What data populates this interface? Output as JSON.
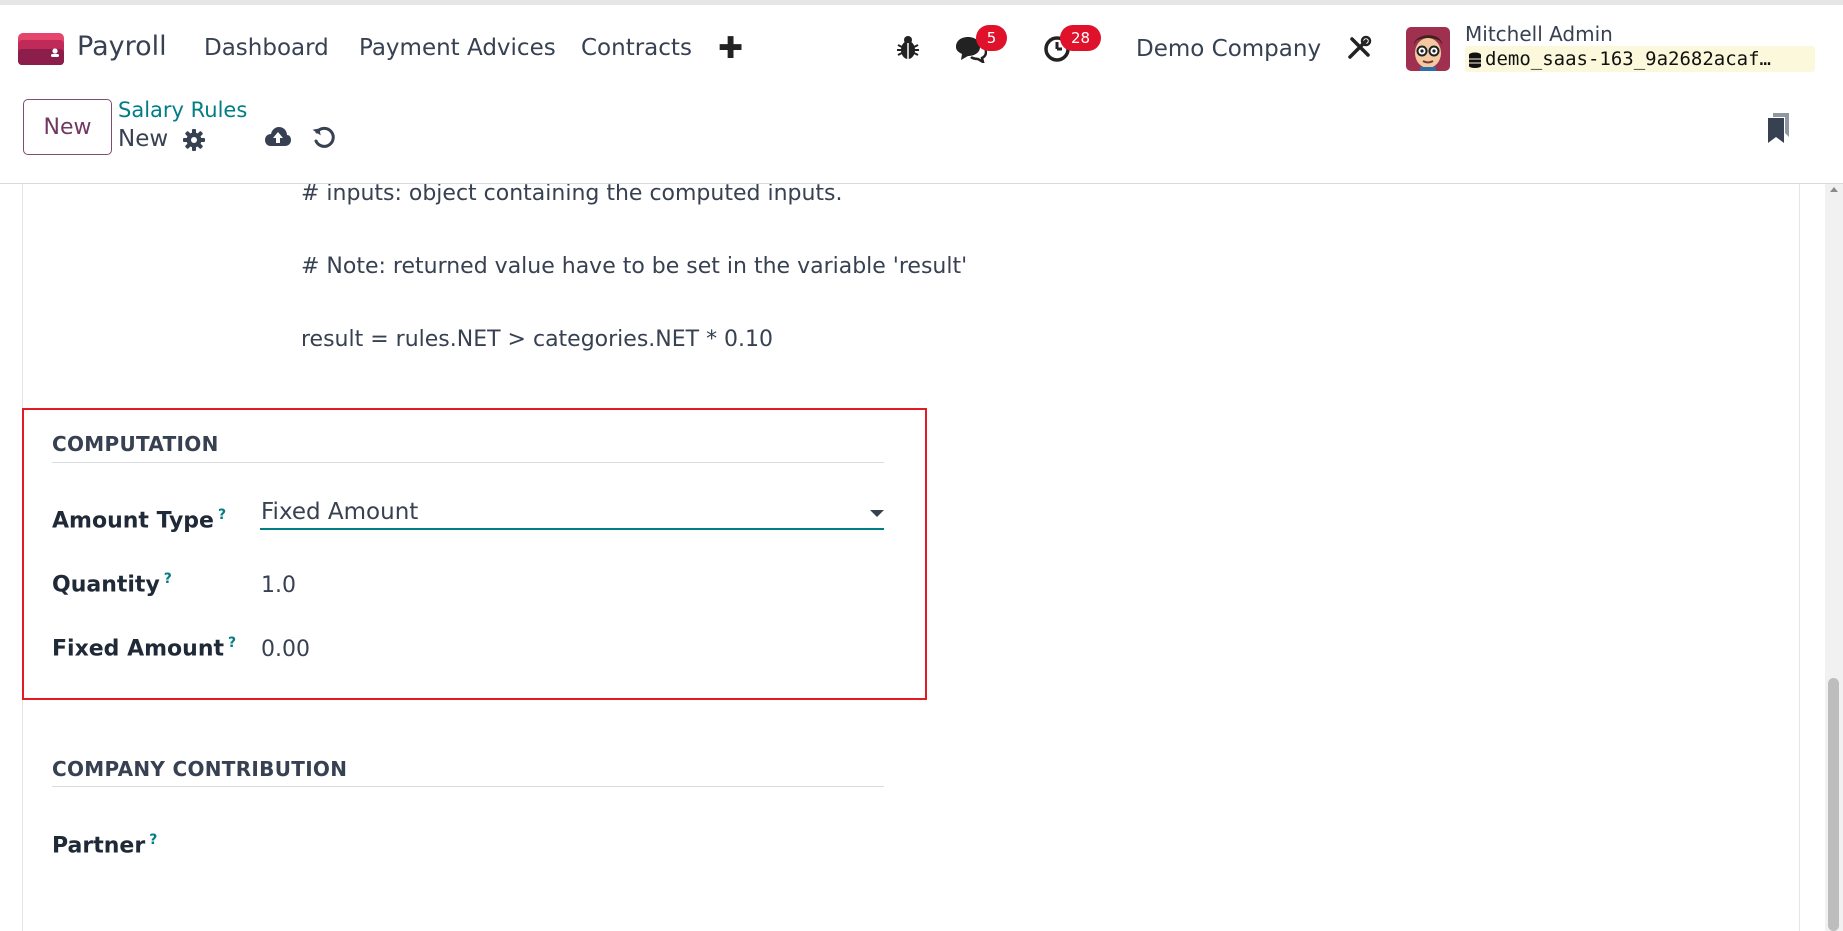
{
  "navbar": {
    "app_name": "Payroll",
    "menu": [
      "Dashboard",
      "Payment Advices",
      "Contracts"
    ],
    "add_icon": "plus-icon",
    "messages_badge": "5",
    "activities_badge": "28",
    "company": "Demo Company",
    "user_name": "Mitchell Admin",
    "database": "demo_saas-163_9a2682acaf…",
    "brand_color": "#71395f",
    "badge_color": "#e0112b"
  },
  "control_panel": {
    "new_button": "New",
    "breadcrumb_parent": "Salary Rules",
    "breadcrumb_current": "New",
    "icons": [
      "gear-icon",
      "cloud-upload-icon",
      "undo-icon",
      "bookmark-icon"
    ]
  },
  "code": {
    "line_inputs": "# inputs: object containing the computed inputs.",
    "line_note": "# Note: returned value have to be set in the variable 'result'",
    "line_result": "result = rules.NET > categories.NET * 0.10"
  },
  "computation": {
    "title": "COMPUTATION",
    "amount_type_label": "Amount Type",
    "amount_type_value": "Fixed Amount",
    "quantity_label": "Quantity",
    "quantity_value": "1.0",
    "fixed_amount_label": "Fixed Amount",
    "fixed_amount_value": "0.00",
    "help_mark": "?"
  },
  "company_contribution": {
    "title": "COMPANY CONTRIBUTION",
    "partner_label": "Partner",
    "help_mark": "?"
  },
  "accent_color": "#017e84",
  "highlight_color": "#e31b23"
}
